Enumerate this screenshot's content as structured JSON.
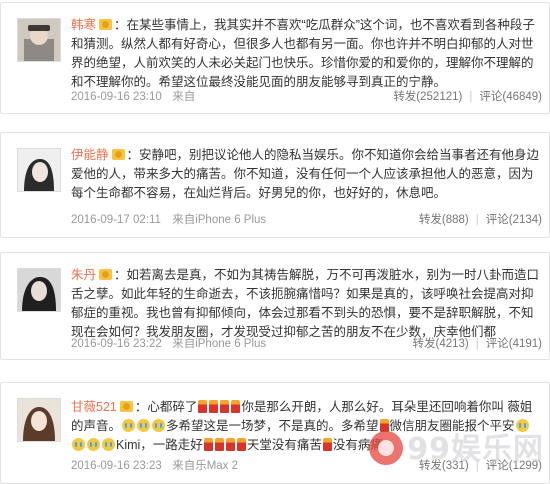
{
  "comments": [
    {
      "user": "韩寒",
      "text": "在某些事情上，我其实并不喜欢“吃瓜群众”这个词，也不喜欢看到各种段子和猜测。纵然人都有好奇心，但很多人也都有另一面。你也许并不明白抑郁的人对世界的绝望，人前欢笑的人未必关起门也快乐。珍惜你爱的和爱你的，理解你不理解的和不理解你的。希望这位最终没能见面的朋友能够寻到真正的宁静。",
      "time": "2016-09-16 23:10",
      "source": "来自",
      "repost": "转发(252121)",
      "comment": "评论(46849)"
    },
    {
      "user": "伊能静",
      "text": "安静吧，别把议论他人的隐私当娱乐。你不知道你会给当事者还有他身边爱他的人，带来多大的痛苦。你不知道，没有任何一个人应该承担他人的恶意，因为每个生命都不容易，在灿烂背后。好男兒的你，也好好的，休息吧。",
      "time": "2016-09-17 02:11",
      "source": "来自iPhone 6 Plus",
      "repost": "转发(888)",
      "comment": "评论(2134)"
    },
    {
      "user": "朱丹",
      "text": "如若离去是真，不如为其祷告解脱，万不可再泼脏水，别为一时八卦而造口舌之孽。如此年轻的生命逝去，不该扼腕痛惜吗？如果是真的，该呼唤社会提高对抑郁症的重视。我也曾有抑郁倾向，体会过那看不到头的恐惧，要不是辞职解脱，不知现在会如何？我发朋友圈，才发现受过抑郁之苦的朋友不在少数，庆幸他们都",
      "time": "2016-09-16 23:22",
      "source": "来自iPhone 6 Plus",
      "repost": "转发(4213)",
      "comment": "评论(4191)"
    },
    {
      "user": "甘薇521",
      "text_a": "心都碎了",
      "text_b": "你是那么开朗，人那么好。耳朵里还回响着你叫 薇姐 的声音。",
      "text_c": "多希望这是一场梦，不是真的。多希望",
      "text_d": "微信朋友圈能报个平安",
      "text_e": "Kimi，一路走好",
      "text_f": "天堂没有痛苦",
      "text_g": "没有病痛",
      "time": "2016-09-16 23:23",
      "source": "来自乐Max 2",
      "repost": "转发(331)",
      "comment": "评论(1299)"
    }
  ],
  "watermark": "99娱乐网"
}
